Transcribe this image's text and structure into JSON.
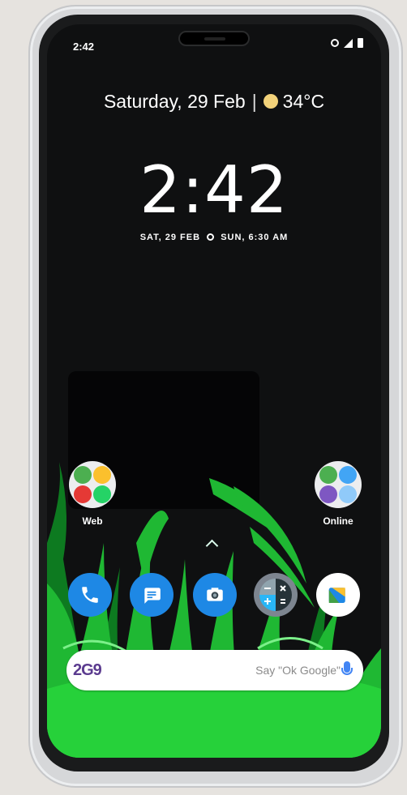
{
  "status_bar": {
    "time": "2:42"
  },
  "lock_header": {
    "date": "Saturday, 29 Feb",
    "separator": "|",
    "temperature": "34°C",
    "weather_icon": "sun-cloud-icon"
  },
  "clock": {
    "time": "2:42",
    "subline_date": "SAT, 29 FEB",
    "subline_alarm": "SUN, 6:30 AM"
  },
  "folders": [
    {
      "label": "Web"
    },
    {
      "label": "Online"
    }
  ],
  "dock": [
    {
      "name": "phone",
      "icon": "phone-icon",
      "color": "#1e88e5"
    },
    {
      "name": "messages",
      "icon": "message-icon",
      "color": "#1e88e5"
    },
    {
      "name": "camera",
      "icon": "camera-icon",
      "color": "#1e88e5"
    },
    {
      "name": "calculator",
      "icon": "calculator-icon",
      "color": "#7d8590"
    },
    {
      "name": "files",
      "icon": "files-icon",
      "color": "#ffffff"
    }
  ],
  "search": {
    "logo_text": "2G9",
    "placeholder": "Say \"Ok Google\""
  },
  "colors": {
    "grass_green": "#26d13a",
    "screen_bg": "#0f1011",
    "accent_blue": "#1e88e5"
  }
}
